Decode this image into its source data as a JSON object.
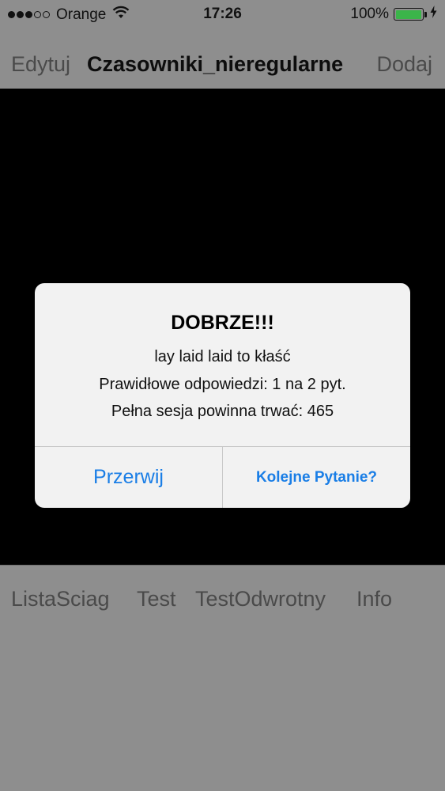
{
  "status_bar": {
    "carrier": "Orange",
    "time": "17:26",
    "battery_percent": "100%",
    "battery_level": 1.0,
    "signal_bars_filled": 3,
    "signal_bars_total": 5
  },
  "nav_bar": {
    "left_label": "Edytuj",
    "title": "Czasowniki_nieregularne",
    "right_label": "Dodaj"
  },
  "alert": {
    "title": "DOBRZE!!!",
    "line1": "lay laid laid to kłaść",
    "line2": "Prawidłowe odpowiedzi: 1 na 2 pyt.",
    "line3": "Pełna sesja powinna trwać: 465",
    "cancel_label": "Przerwij",
    "next_label": "Kolejne Pytanie?"
  },
  "tab_bar": {
    "items": [
      {
        "label": "ListaSciag"
      },
      {
        "label": "Test"
      },
      {
        "label": "TestOdwrotny"
      },
      {
        "label": "Info"
      }
    ]
  },
  "colors": {
    "accent": "#1a7ee6",
    "background": "#8e8e8e",
    "battery": "#3bb54a"
  },
  "icons": [
    "signal-icon",
    "wifi-icon",
    "battery-icon",
    "charging-icon"
  ]
}
